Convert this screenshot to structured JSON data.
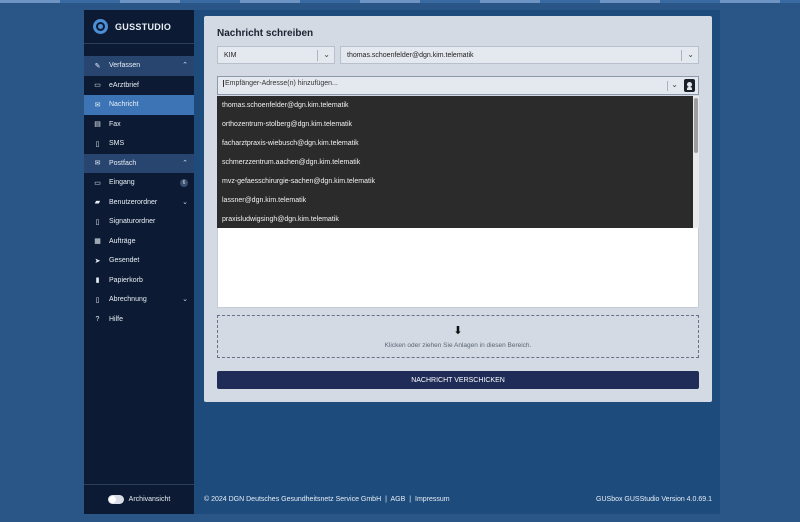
{
  "brand": {
    "name": "GUSSTUDIO"
  },
  "sidebar": {
    "sections": [
      {
        "label": "Verfassen",
        "icon": "edit-icon",
        "chev": "⌃",
        "items": [
          {
            "label": "eArztbrief",
            "icon": "inbox-icon"
          },
          {
            "label": "Nachricht",
            "icon": "message-icon",
            "active": true
          },
          {
            "label": "Fax",
            "icon": "fax-icon"
          },
          {
            "label": "SMS",
            "icon": "sms-icon"
          }
        ]
      },
      {
        "label": "Postfach",
        "icon": "mail-icon",
        "chev": "⌃",
        "items": [
          {
            "label": "Eingang",
            "icon": "inbox-icon",
            "badge": "6"
          },
          {
            "label": "Benutzerordner",
            "icon": "folder-icon",
            "chev": "⌄"
          },
          {
            "label": "Signaturordner",
            "icon": "document-icon"
          },
          {
            "label": "Aufträge",
            "icon": "tasks-icon"
          },
          {
            "label": "Gesendet",
            "icon": "send-icon"
          },
          {
            "label": "Papierkorb",
            "icon": "trash-icon"
          }
        ]
      }
    ],
    "extra": [
      {
        "label": "Abrechnung",
        "icon": "file-icon",
        "chev": "⌄"
      },
      {
        "label": "Hilfe",
        "icon": "help-icon"
      }
    ],
    "archive_label": "Archivansicht"
  },
  "compose": {
    "title": "Nachricht schreiben",
    "channel_value": "KIM",
    "sender_value": "thomas.schoenfelder@dgn.kim.telematik",
    "recipient_placeholder": "Empfänger-Adresse(n) hinzufügen...",
    "suggestions": [
      "thomas.schoenfelder@dgn.kim.telematik",
      "orthozentrum-stolberg@dgn.kim.telematik",
      "facharztpraxis-wiebusch@dgn.kim.telematik",
      "schmerzzentrum.aachen@dgn.kim.telematik",
      "mvz-gefaesschirurgie-sachen@dgn.kim.telematik",
      "lassner@dgn.kim.telematik",
      "praxisludwigsingh@dgn.kim.telematik"
    ],
    "dropzone_text": "Klicken oder ziehen Sie Anlagen in diesen Bereich.",
    "send_label": "NACHRICHT VERSCHICKEN"
  },
  "footer": {
    "copyright": "© 2024 DGN Deutsches Gesundheitsnetz Service GmbH",
    "sep": "|",
    "agb": "AGB",
    "impressum": "Impressum",
    "version": "GUSbox GUSStudio Version 4.0.69.1"
  }
}
